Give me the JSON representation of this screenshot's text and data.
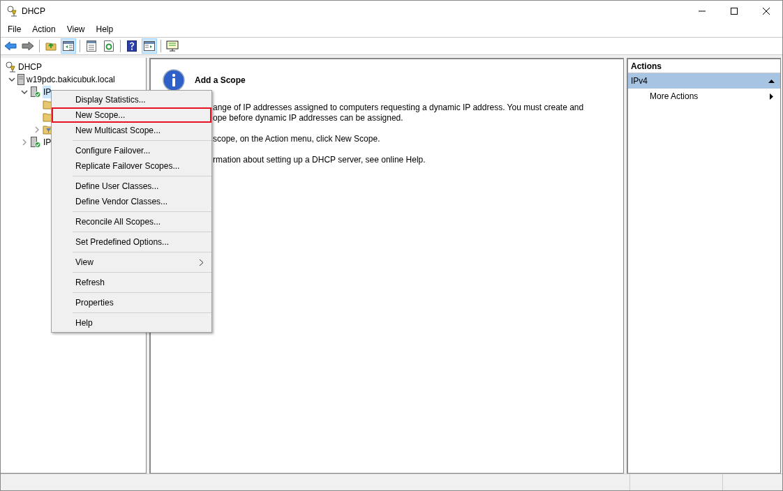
{
  "window": {
    "title": "DHCP"
  },
  "menubar": [
    "File",
    "Action",
    "View",
    "Help"
  ],
  "toolbar": [
    {
      "kind": "back",
      "pressed": false
    },
    {
      "kind": "forward",
      "pressed": false
    },
    {
      "kind": "sep"
    },
    {
      "kind": "up",
      "pressed": false
    },
    {
      "kind": "tree",
      "pressed": true
    },
    {
      "kind": "sep"
    },
    {
      "kind": "export",
      "pressed": false
    },
    {
      "kind": "refresh",
      "pressed": false
    },
    {
      "kind": "sep"
    },
    {
      "kind": "help",
      "pressed": false
    },
    {
      "kind": "pane",
      "pressed": true
    },
    {
      "kind": "sep"
    },
    {
      "kind": "monitor",
      "pressed": false
    }
  ],
  "tree": [
    {
      "label": "DHCP",
      "kind": "root",
      "children": [
        {
          "label": "w19pdc.bakicubuk.local",
          "kind": "server",
          "expanded": true,
          "children": [
            {
              "label": "IP",
              "kind": "ip",
              "expanded": true,
              "selected": true,
              "children": [
                {
                  "kind": "folder"
                },
                {
                  "kind": "folder"
                },
                {
                  "kind": "filter",
                  "expandable": true
                }
              ]
            },
            {
              "label": "IP",
              "kind": "ip",
              "expanded": false,
              "selected": false
            }
          ]
        }
      ]
    }
  ],
  "content": {
    "heading": "Add a Scope",
    "paragraphs": [
      [
        "ange of IP addresses assigned to computers requesting a dynamic IP address. You must create and",
        "ope before dynamic IP addresses can be assigned."
      ],
      [
        "scope, on the Action menu, click New Scope."
      ],
      [
        "rmation about setting up a DHCP server, see online Help."
      ]
    ]
  },
  "actions": {
    "title": "Actions",
    "section": "IPv4",
    "items": [
      {
        "label": "More Actions",
        "submenu": true
      }
    ]
  },
  "context_menu": {
    "groups": [
      [
        {
          "label": "Display Statistics...",
          "selected": false,
          "submenu": false
        },
        {
          "label": "New Scope...",
          "selected": true,
          "submenu": false
        },
        {
          "label": "New Multicast Scope...",
          "selected": false,
          "submenu": false
        }
      ],
      [
        {
          "label": "Configure Failover...",
          "selected": false,
          "submenu": false
        },
        {
          "label": "Replicate Failover Scopes...",
          "selected": false,
          "submenu": false
        }
      ],
      [
        {
          "label": "Define User Classes...",
          "selected": false,
          "submenu": false
        },
        {
          "label": "Define Vendor Classes...",
          "selected": false,
          "submenu": false
        }
      ],
      [
        {
          "label": "Reconcile All Scopes...",
          "selected": false,
          "submenu": false
        }
      ],
      [
        {
          "label": "Set Predefined Options...",
          "selected": false,
          "submenu": false
        }
      ],
      [
        {
          "label": "View",
          "selected": false,
          "submenu": true
        }
      ],
      [
        {
          "label": "Refresh",
          "selected": false,
          "submenu": false
        }
      ],
      [
        {
          "label": "Properties",
          "selected": false,
          "submenu": false
        }
      ],
      [
        {
          "label": "Help",
          "selected": false,
          "submenu": false
        }
      ]
    ]
  }
}
